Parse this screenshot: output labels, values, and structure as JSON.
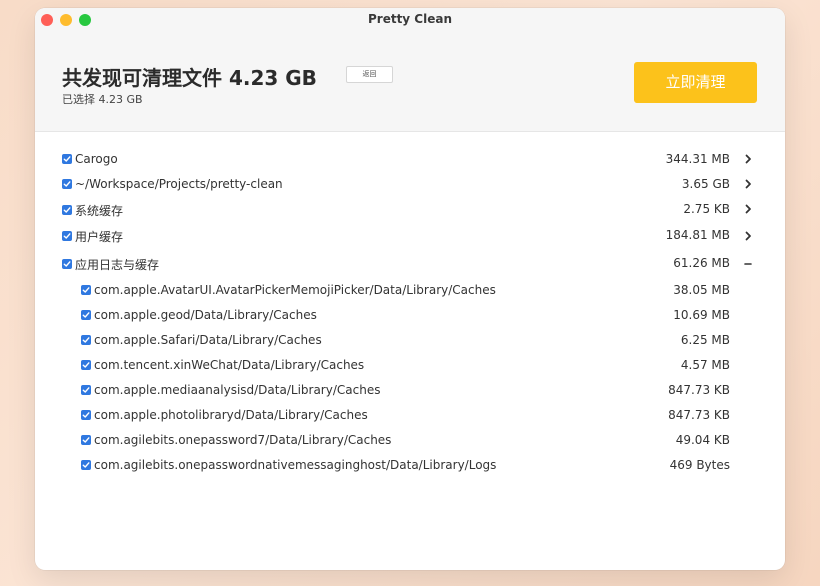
{
  "window": {
    "title": "Pretty Clean",
    "colors": {
      "accent": "#fcc21b",
      "checkbox": "#2f78e0",
      "close": "#ff5f57",
      "minimize": "#febc2e",
      "zoom": "#28c840"
    }
  },
  "header": {
    "headline": "共发现可清理文件 4.23 GB",
    "back_label": "返回",
    "selected_text": "已选择 4.23 GB",
    "clean_button": "立即清理"
  },
  "items": [
    {
      "label": "Carogo",
      "size": "344.31 MB",
      "expander": "chevron-right-icon"
    },
    {
      "label": "~/Workspace/Projects/pretty-clean",
      "size": "3.65 GB",
      "expander": "chevron-right-icon"
    },
    {
      "label": "系统缓存",
      "size": "2.75 KB",
      "expander": "chevron-right-icon"
    },
    {
      "label": "用户缓存",
      "size": "184.81 MB",
      "expander": "chevron-right-icon"
    },
    {
      "label": "应用日志与缓存",
      "size": "61.26 MB",
      "expander": "collapse-dash-icon"
    }
  ],
  "subitems": [
    {
      "label": "com.apple.AvatarUI.AvatarPickerMemojiPicker/Data/Library/Caches",
      "size": "38.05 MB"
    },
    {
      "label": "com.apple.geod/Data/Library/Caches",
      "size": "10.69 MB"
    },
    {
      "label": "com.apple.Safari/Data/Library/Caches",
      "size": "6.25 MB"
    },
    {
      "label": "com.tencent.xinWeChat/Data/Library/Caches",
      "size": "4.57 MB"
    },
    {
      "label": "com.apple.mediaanalysisd/Data/Library/Caches",
      "size": "847.73 KB"
    },
    {
      "label": "com.apple.photolibraryd/Data/Library/Caches",
      "size": "847.73 KB"
    },
    {
      "label": "com.agilebits.onepassword7/Data/Library/Caches",
      "size": "49.04 KB"
    },
    {
      "label": "com.agilebits.onepasswordnativemessaginghost/Data/Library/Logs",
      "size": "469 Bytes"
    }
  ]
}
